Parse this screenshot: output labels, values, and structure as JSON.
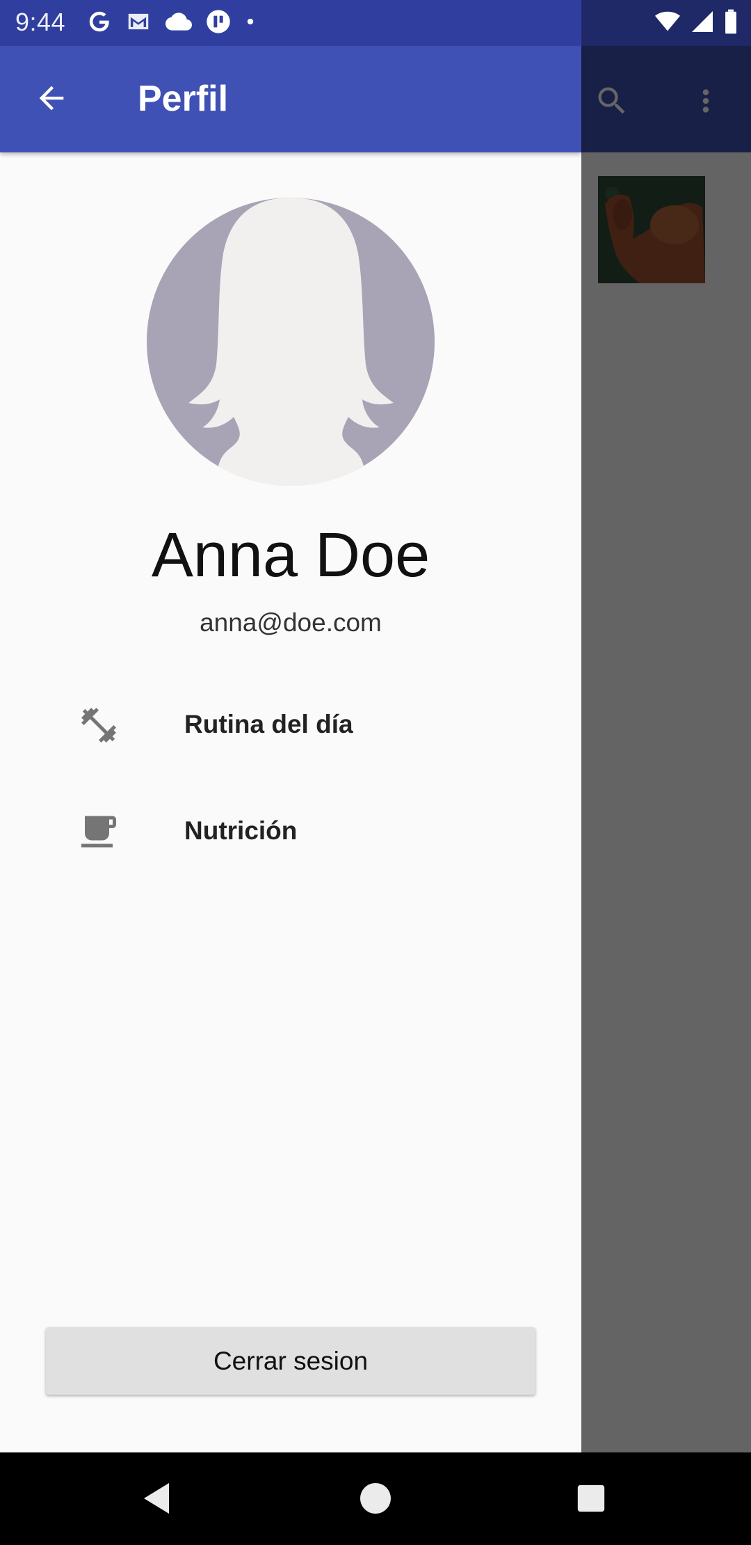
{
  "status_bar": {
    "time": "9:44",
    "left_icons": [
      "google-icon",
      "gmail-icon",
      "cloud-icon",
      "app-icon",
      "dot-icon"
    ],
    "right_icons": [
      "wifi-icon",
      "signal-icon",
      "battery-icon"
    ]
  },
  "background_app": {
    "appbar_icons": [
      "search-icon",
      "more-vert-icon"
    ],
    "thumbnail": "biceps-image"
  },
  "drawer": {
    "title": "Perfil",
    "back_icon": "arrow-back-icon",
    "profile": {
      "name": "Anna Doe",
      "email": "anna@doe.com"
    },
    "menu": [
      {
        "label": "Rutina del día",
        "icon": "dumbbell-icon"
      },
      {
        "label": "Nutrición",
        "icon": "coffee-cup-icon"
      }
    ],
    "logout_label": "Cerrar sesion"
  },
  "colors": {
    "primary": "#3f51b5",
    "primary_dark": "#303f9f",
    "drawer_bg": "#fafafa",
    "button_bg": "#e0e0e0",
    "icon_gray": "#757575"
  },
  "nav_bar": {
    "buttons": [
      "back-triangle-icon",
      "home-circle-icon",
      "recents-square-icon"
    ]
  }
}
